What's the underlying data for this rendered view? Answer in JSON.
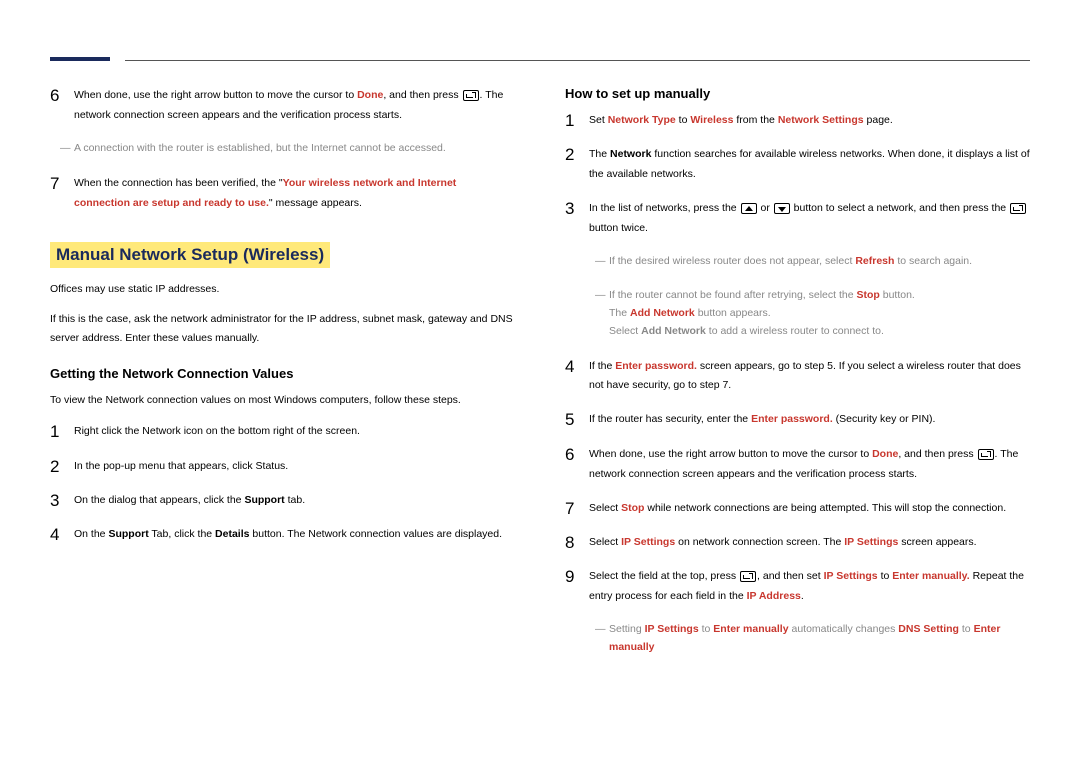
{
  "left": {
    "step6_a": "When done, use the right arrow button to move the cursor to ",
    "step6_done": "Done",
    "step6_b": ", and then press ",
    "step6_c": ". The network connection screen appears and the verification process starts.",
    "note1": "A connection with the router is established, but the Internet cannot be accessed.",
    "step7_a": "When the connection has been verified, the \"",
    "step7_red": "Your wireless network and Internet connection are setup and ready to use.",
    "step7_b": "\" message appears.",
    "section_title": "Manual Network Setup (Wireless)",
    "intro1": "Offices may use static IP addresses.",
    "intro2": "If this is the case, ask the network administrator for the IP address, subnet mask, gateway and DNS server address. Enter these values manually.",
    "sub1": "Getting the Network Connection Values",
    "sub1_intro": "To view the Network connection values on most Windows computers, follow these steps.",
    "g1": "Right click the Network icon on the bottom right of the screen.",
    "g2": "In the pop-up menu that appears, click Status.",
    "g3_a": "On the dialog that appears, click the ",
    "g3_support": "Support",
    "g3_b": " tab.",
    "g4_a": "On the ",
    "g4_support": "Support",
    "g4_b": " Tab, click the ",
    "g4_details": "Details",
    "g4_c": " button. The Network connection values are displayed."
  },
  "right": {
    "sub2": "How to set up manually",
    "s1_a": "Set ",
    "s1_nt": "Network Type",
    "s1_b": " to ",
    "s1_w": "Wireless",
    "s1_c": " from the ",
    "s1_ns": "Network Settings",
    "s1_d": " page.",
    "s2_a": "The ",
    "s2_n": "Network",
    "s2_b": " function searches for available wireless networks. When done, it displays a list of the available networks.",
    "s3_a": "In the list of networks, press the ",
    "s3_b": " or ",
    "s3_c": " button to select a network, and then press the ",
    "s3_d": " button twice.",
    "note2_a": "If the desired wireless router does not appear, select ",
    "note2_refresh": "Refresh",
    "note2_b": " to search again.",
    "note3_a": "If the router cannot be found after retrying, select the ",
    "note3_stop": "Stop",
    "note3_b": " button.",
    "note3_line2_a": "The ",
    "note3_line2_an": "Add Network",
    "note3_line2_b": " button appears.",
    "note3_line3_a": "Select ",
    "note3_line3_an": "Add Network",
    "note3_line3_b": " to add a wireless router to connect to.",
    "s4_a": "If the ",
    "s4_ep": "Enter password.",
    "s4_b": " screen appears, go to step 5. If you select a wireless router that does not have security, go to step 7.",
    "s5_a": "If the router has security, enter the ",
    "s5_ep": "Enter password.",
    "s5_b": " (Security key or PIN).",
    "s6_a": "When done, use the right arrow button to move the cursor to ",
    "s6_done": "Done",
    "s6_b": ", and then press ",
    "s6_c": ". The network connection screen appears and the verification process starts.",
    "s7_a": "Select ",
    "s7_stop": "Stop",
    "s7_b": " while network connections are being attempted. This will stop the connection.",
    "s8_a": "Select ",
    "s8_ip": "IP Settings",
    "s8_b": " on network connection screen. The ",
    "s8_ip2": "IP Settings",
    "s8_c": " screen appears.",
    "s9_a": "Select the field at the top, press ",
    "s9_b": ", and then set ",
    "s9_ip": "IP Settings",
    "s9_c": " to ",
    "s9_em": "Enter manually.",
    "s9_d": " Repeat the entry process for each field in the ",
    "s9_ipa": "IP Address",
    "s9_e": ".",
    "note4_a": "Setting ",
    "note4_ip": "IP Settings",
    "note4_b": " to ",
    "note4_em": "Enter manually",
    "note4_c": " automatically changes ",
    "note4_dns": "DNS Setting",
    "note4_d": " to ",
    "note4_em2": "Enter manually"
  }
}
